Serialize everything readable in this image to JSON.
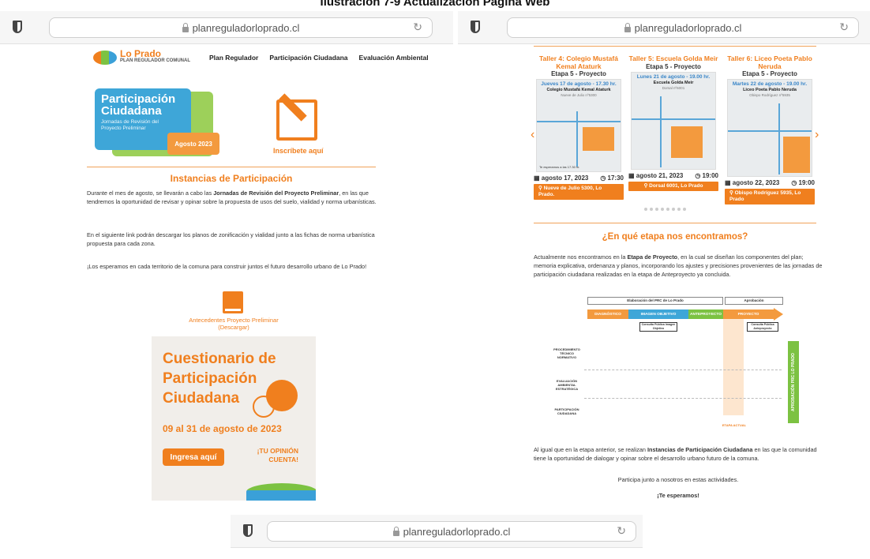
{
  "caption": "Ilustración 7-9 Actualización Página Web",
  "browser": {
    "url": "planreguladorloprado.cl"
  },
  "left": {
    "logo": {
      "name": "Lo Prado",
      "sub": "PLAN REGULADOR COMUNAL"
    },
    "nav": [
      "Plan Regulador",
      "Participación Ciudadana",
      "Evaluación Ambiental"
    ],
    "banner": {
      "title": "Participación Ciudadana",
      "subtitle": "Jornadas de Revisión del Proyecto Preliminar",
      "date": "Agosto 2023"
    },
    "signup_label": "Inscríbete aquí",
    "section_title": "Instancias de Participación",
    "p1_pre": "Durante el mes de agosto, se llevarán a cabo las ",
    "p1_bold": "Jornadas de Revisión del Proyecto Preliminar",
    "p1_post": ", en las que tendremos la oportunidad de revisar y opinar sobre la propuesta de usos del suelo, vialidad y norma urbanísticas.",
    "p2": "En el siguiente link podrán descargar los planos de zonificación y vialidad junto a las fichas de norma urbanística propuesta para cada zona.",
    "p3": "¡Los esperamos en cada territorio de la comuna para construir juntos el futuro desarrollo urbano de Lo Prado!",
    "download_label": "Antecedentes Proyecto Preliminar (Descargar)",
    "questionnaire": {
      "title": "Cuestionario de Participación Ciudadana",
      "dates": "09 al 31 de agosto de 2023",
      "button": "Ingresa aquí",
      "tagline": "¡TU OPINIÓN CUENTA!"
    }
  },
  "right": {
    "cards": [
      {
        "title": "Taller 4: Colegio Mustafá Kemal Ataturk",
        "stage": "Etapa 5 - Proyecto",
        "map_head": "Jueves 17 de agosto - 17.30 hr.",
        "map_place": "Colegio Mustafá Kemal Ataturk",
        "map_addr": "Nueve de Julio nº5300",
        "date": "agosto 17, 2023",
        "time": "17:30",
        "location": "Nueve de Julio 5300, Lo Prado."
      },
      {
        "title": "Taller 5: Escuela Golda Meir",
        "stage": "Etapa 5 - Proyecto",
        "map_head": "Lunes 21 de agosto - 19.00 hr.",
        "map_place": "Escuela Golda Meir",
        "map_addr": "Dorsal nº6001",
        "date": "agosto 21, 2023",
        "time": "19:00",
        "location": "Dorsal 6001, Lo Prado"
      },
      {
        "title": "Taller 6: Liceo Poeta Pablo Neruda",
        "stage": "Etapa 5 - Proyecto",
        "map_head": "Martes 22 de agosto - 19.00 hr.",
        "map_place": "Liceo Poeta Pablo Neruda",
        "map_addr": "Obispo Rodríguez nº5935",
        "date": "agosto 22, 2023",
        "time": "19:00",
        "location": "Obispo Rodríguez 5935, Lo Prado"
      }
    ],
    "map_note": "Te esperamos a las 17.30 hr.",
    "section_title": "¿En qué etapa nos encontramos?",
    "p1_pre": "Actualmente nos encontramos en la ",
    "p1_bold": "Etapa de Proyecto",
    "p1_post": ", en la cual se diseñan los componentes del plan; memoria explicativa, ordenanza y planos, incorporando los ajustes y precisiones provenientes de las jornadas de participación ciudadana realizadas en la etapa de Anteproyecto ya concluida.",
    "diagram": {
      "header_left": "Elaboración del PRC de Lo Prado",
      "header_right": "Aprobación",
      "stages": [
        "DIAGNÓSTICO",
        "IMAGEN OBJETIVO",
        "ANTEPROYECTO",
        "PROYECTO"
      ],
      "rows": [
        "PROCEDIMIENTO TÉCNICO NORMATIVO",
        "EVALUACIÓN AMBIENTAL ESTRATÉGICA",
        "PARTICIPACIÓN CIUDADANA"
      ],
      "consult_io": "Consulta Pública Imagen Objetivo",
      "consult_ap": "Consulta Pública Anteproyecto",
      "vertical": "APROBACIÓN PRC LO PRADO",
      "current": "ETAPA ACTUAL"
    },
    "p2_pre": "Al igual que en la etapa anterior, se realizan ",
    "p2_bold": "Instancias de Participación Ciudadana",
    "p2_post": " en las que la comunidad tiene la oportunidad de dialogar y opinar sobre el desarrollo urbano futuro de la comuna.",
    "p3": "Participa junto a nosotros en estas actividades.",
    "p4": "¡Te esperamos!"
  },
  "colors": {
    "orange": "#f07f1e",
    "blue": "#3ea6d8",
    "green": "#7cc242"
  }
}
